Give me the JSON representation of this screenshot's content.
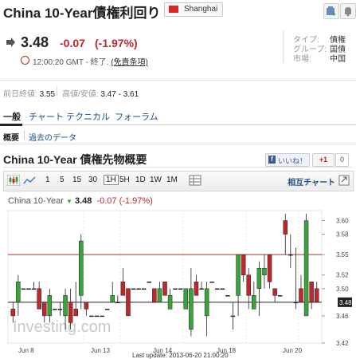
{
  "header": {
    "title": "China 10-Year債権利回り",
    "location": "Shanghai"
  },
  "quote": {
    "price": "3.48",
    "change": "-0.07",
    "change_pct": "(-1.97%)",
    "time": "12:00:20 GMT - 終了.",
    "disclaimer": "(免責条項)",
    "meta": [
      {
        "k": "タイプ:",
        "v": "債権"
      },
      {
        "k": "グループ:",
        "v": "国債"
      },
      {
        "k": "市場:",
        "v": "中国"
      }
    ]
  },
  "stats": {
    "prev_label": "前日終値:",
    "prev_value": "3.55",
    "range_label": "高値/安値:",
    "range_value": "3.47 - 3.61"
  },
  "tabs": [
    "一般",
    "チャート",
    "テクニカル",
    "フォーラム"
  ],
  "subtabs": [
    "概要",
    "過去のデータ"
  ],
  "section": {
    "title": "China 10-Year 債権先物概要",
    "fb_like": "いいね！",
    "gplus": "+1",
    "count": "0"
  },
  "toolbar": {
    "periods": [
      "1",
      "5",
      "15",
      "30",
      "1H",
      "5H",
      "1D",
      "1W",
      "1M"
    ],
    "selected": "1H",
    "interactive_label": "相互チャート"
  },
  "legend": {
    "name": "China 10-Year",
    "price": "3.48",
    "change": "-0.07 (-1.97%)"
  },
  "footer": "Last update: 2013-06-20 21:00:20",
  "watermark": "Investing.com",
  "colors": {
    "up": "#3aa33a",
    "down": "#c0272d",
    "link": "#1a4f8b"
  },
  "chart_data": {
    "type": "candlestick",
    "x_ticks": [
      "Jun 8",
      "Jun 13",
      "Jun 14",
      "Jun 18",
      "Jun 20"
    ],
    "y_ticks": [
      "3.60",
      "3.58",
      "3.55",
      "3.52",
      "3.50",
      "3.48",
      "3.46",
      "3.42"
    ],
    "ylim": [
      3.42,
      3.61
    ],
    "last_price": "3.48",
    "prev_close": 3.55,
    "candles": [
      {
        "o": 3.47,
        "h": 3.48,
        "l": 3.45,
        "c": 3.46
      },
      {
        "o": 3.48,
        "h": 3.52,
        "l": 3.46,
        "c": 3.51
      },
      {
        "o": 3.5,
        "h": 3.5,
        "l": 3.5,
        "c": 3.5
      },
      {
        "o": 3.5,
        "h": 3.5,
        "l": 3.5,
        "c": 3.5
      },
      {
        "o": 3.5,
        "h": 3.51,
        "l": 3.5,
        "c": 3.5
      },
      {
        "o": 3.5,
        "h": 3.51,
        "l": 3.47,
        "c": 3.47
      },
      {
        "o": 3.48,
        "h": 3.48,
        "l": 3.45,
        "c": 3.46
      },
      {
        "o": 3.46,
        "h": 3.5,
        "l": 3.45,
        "c": 3.49
      },
      {
        "o": 3.47,
        "h": 3.47,
        "l": 3.47,
        "c": 3.47
      },
      {
        "o": 3.47,
        "h": 3.48,
        "l": 3.46,
        "c": 3.47
      },
      {
        "o": 3.46,
        "h": 3.5,
        "l": 3.44,
        "c": 3.49
      },
      {
        "o": 3.48,
        "h": 3.5,
        "l": 3.44,
        "c": 3.45
      },
      {
        "o": 3.47,
        "h": 3.51,
        "l": 3.46,
        "c": 3.46
      },
      {
        "o": 3.49,
        "h": 3.58,
        "l": 3.47,
        "c": 3.57
      },
      {
        "o": 3.48,
        "h": 3.48,
        "l": 3.46,
        "c": 3.47
      },
      {
        "o": 3.46,
        "h": 3.46,
        "l": 3.46,
        "c": 3.46
      },
      {
        "o": 3.46,
        "h": 3.46,
        "l": 3.46,
        "c": 3.46
      },
      {
        "o": 3.46,
        "h": 3.46,
        "l": 3.46,
        "c": 3.46
      },
      {
        "o": 3.47,
        "h": 3.47,
        "l": 3.47,
        "c": 3.47
      },
      {
        "o": 3.48,
        "h": 3.51,
        "l": 3.48,
        "c": 3.49
      },
      {
        "o": 3.48,
        "h": 3.49,
        "l": 3.48,
        "c": 3.48
      },
      {
        "o": 3.51,
        "h": 3.53,
        "l": 3.49,
        "c": 3.49
      },
      {
        "o": 3.5,
        "h": 3.5,
        "l": 3.46,
        "c": 3.46
      },
      {
        "o": 3.5,
        "h": 3.5,
        "l": 3.5,
        "c": 3.5
      },
      {
        "o": 3.5,
        "h": 3.5,
        "l": 3.5,
        "c": 3.5
      },
      {
        "o": 3.5,
        "h": 3.5,
        "l": 3.5,
        "c": 3.5
      },
      {
        "o": 3.51,
        "h": 3.51,
        "l": 3.51,
        "c": 3.51
      },
      {
        "o": 3.5,
        "h": 3.5,
        "l": 3.48,
        "c": 3.48
      },
      {
        "o": 3.48,
        "h": 3.51,
        "l": 3.48,
        "c": 3.5
      },
      {
        "o": 3.51,
        "h": 3.51,
        "l": 3.49,
        "c": 3.49
      },
      {
        "o": 3.47,
        "h": 3.5,
        "l": 3.47,
        "c": 3.49
      },
      {
        "o": 3.5,
        "h": 3.5,
        "l": 3.5,
        "c": 3.5
      },
      {
        "o": 3.5,
        "h": 3.5,
        "l": 3.5,
        "c": 3.5
      },
      {
        "o": 3.47,
        "h": 3.5,
        "l": 3.47,
        "c": 3.5
      },
      {
        "o": 3.44,
        "h": 3.53,
        "l": 3.43,
        "c": 3.5
      },
      {
        "o": 3.51,
        "h": 3.52,
        "l": 3.49,
        "c": 3.49
      },
      {
        "o": 3.5,
        "h": 3.51,
        "l": 3.5,
        "c": 3.5
      },
      {
        "o": 3.46,
        "h": 3.51,
        "l": 3.43,
        "c": 3.5
      },
      {
        "o": 3.51,
        "h": 3.51,
        "l": 3.51,
        "c": 3.51
      },
      {
        "o": 3.5,
        "h": 3.5,
        "l": 3.5,
        "c": 3.5
      },
      {
        "o": 3.5,
        "h": 3.5,
        "l": 3.5,
        "c": 3.5
      },
      {
        "o": 3.49,
        "h": 3.49,
        "l": 3.49,
        "c": 3.49
      },
      {
        "o": 3.46,
        "h": 3.48,
        "l": 3.44,
        "c": 3.46
      },
      {
        "o": 3.49,
        "h": 3.55,
        "l": 3.46,
        "c": 3.55
      },
      {
        "o": 3.55,
        "h": 3.55,
        "l": 3.51,
        "c": 3.52
      },
      {
        "o": 3.52,
        "h": 3.53,
        "l": 3.47,
        "c": 3.49
      },
      {
        "o": 3.47,
        "h": 3.51,
        "l": 3.47,
        "c": 3.49
      },
      {
        "o": 3.5,
        "h": 3.54,
        "l": 3.46,
        "c": 3.53
      },
      {
        "o": 3.52,
        "h": 3.55,
        "l": 3.5,
        "c": 3.53
      },
      {
        "o": 3.55,
        "h": 3.55,
        "l": 3.5,
        "c": 3.51
      },
      {
        "o": 3.5,
        "h": 3.5,
        "l": 3.48,
        "c": 3.49
      },
      {
        "o": 3.49,
        "h": 3.49,
        "l": 3.49,
        "c": 3.49
      },
      {
        "o": 3.6,
        "h": 3.61,
        "l": 3.55,
        "c": 3.58
      },
      {
        "o": 3.55,
        "h": 3.58,
        "l": 3.53,
        "c": 3.55
      },
      {
        "o": 3.48,
        "h": 3.56,
        "l": 3.47,
        "c": 3.48
      },
      {
        "o": 3.5,
        "h": 3.52,
        "l": 3.48,
        "c": 3.48
      },
      {
        "o": 3.46,
        "h": 3.61,
        "l": 3.46,
        "c": 3.6
      },
      {
        "o": 3.51,
        "h": 3.51,
        "l": 3.47,
        "c": 3.48
      },
      {
        "o": 3.5,
        "h": 3.51,
        "l": 3.48,
        "c": 3.48
      }
    ]
  }
}
